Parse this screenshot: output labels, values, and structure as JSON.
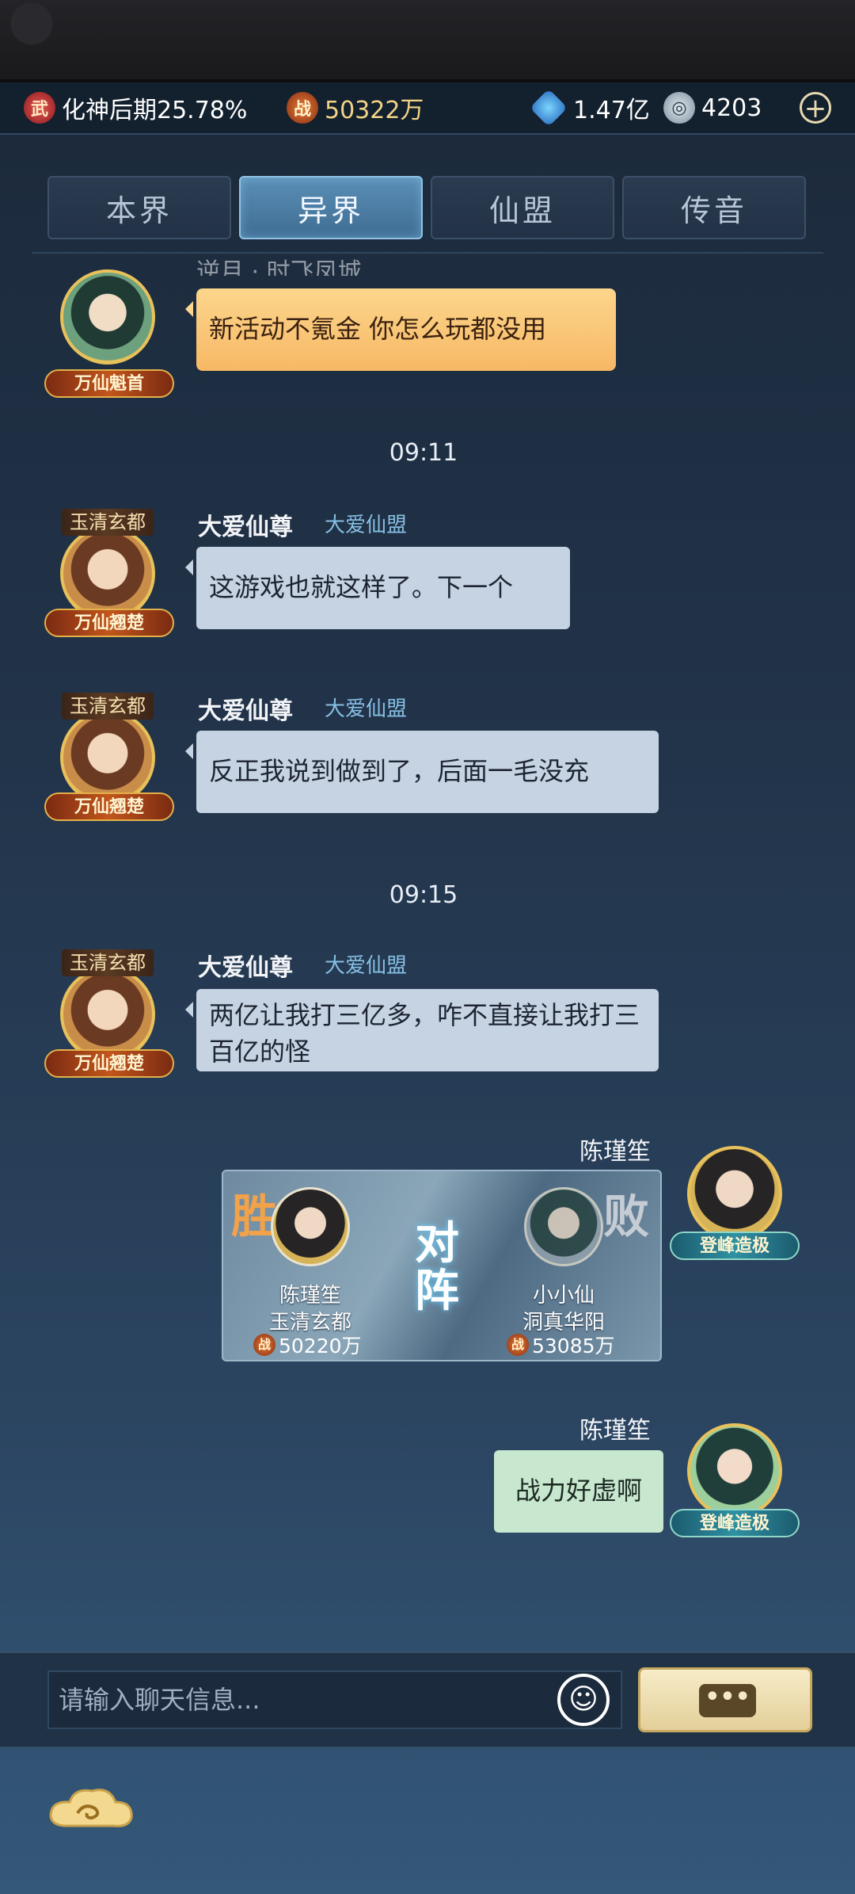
{
  "status_bar": {
    "realm_icon": "wu-icon",
    "realm_icon_glyph": "武",
    "realm_text": "化神后期25.78%",
    "power_icon_glyph": "战",
    "power_value": "50322万",
    "crystal_value": "1.47亿",
    "coin_value": "4203",
    "add_icon": "+"
  },
  "tabs": [
    {
      "label": "本界",
      "active": false
    },
    {
      "label": "异界",
      "active": true
    },
    {
      "label": "仙盟",
      "active": false
    },
    {
      "label": "传音",
      "active": false
    }
  ],
  "messages": {
    "m0": {
      "sender_partial": "逆月 · 时飞凤城",
      "text": "新活动不氪金  你怎么玩都没用",
      "badge": "万仙魁首"
    },
    "ts1": "09:11",
    "m1": {
      "title": "玉清玄都",
      "sender": "大爱仙尊",
      "guild": "大爱仙盟",
      "text": "这游戏也就这样了。下一个",
      "badge": "万仙翘楚"
    },
    "m2": {
      "title": "玉清玄都",
      "sender": "大爱仙尊",
      "guild": "大爱仙盟",
      "text": "反正我说到做到了，后面一毛没充",
      "badge": "万仙翘楚"
    },
    "ts2": "09:15",
    "m3": {
      "title": "玉清玄都",
      "sender": "大爱仙尊",
      "guild": "大爱仙盟",
      "text": "两亿让我打三亿多，咋不直接让我打三百亿的怪",
      "badge": "万仙翘楚"
    },
    "m4": {
      "sender": "陈瑾笙",
      "badge": "登峰造极"
    },
    "battle": {
      "win_label": "胜",
      "lose_label": "败",
      "vs_1": "对",
      "vs_2": "阵",
      "left_name": "陈瑾笙",
      "left_realm": "玉清玄都",
      "left_power": "50220万",
      "right_name": "小小仙",
      "right_realm": "洞真华阳",
      "right_power": "53085万",
      "power_glyph": "战"
    },
    "m5": {
      "sender": "陈瑾笙",
      "text": "战力好虚啊",
      "badge": "登峰造极"
    }
  },
  "input": {
    "placeholder": "请输入聊天信息...",
    "emoji_icon": "☺",
    "send_icon": "•••"
  },
  "colors": {
    "bubble_default": "#c6d3e2",
    "bubble_gold": "#f7b865",
    "bubble_green": "#c8e7cf",
    "tab_active": "#4f82a9",
    "guild_text": "#86bfe4"
  }
}
